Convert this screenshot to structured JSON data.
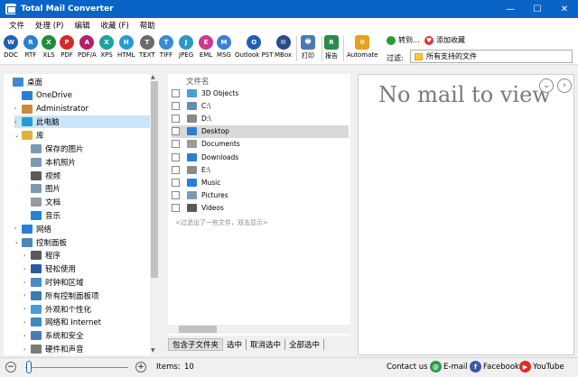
{
  "window": {
    "title": "Total Mail Converter",
    "minimize": "—",
    "maximize": "☐",
    "close": "✕"
  },
  "menu": [
    "文件",
    "处理 (P)",
    "编辑",
    "收藏 (F)",
    "帮助"
  ],
  "toolbar": {
    "formats": [
      {
        "label": "DOC",
        "icon": "W",
        "color": "#1f5fb4"
      },
      {
        "label": "RTF",
        "icon": "R",
        "color": "#2a7fd4"
      },
      {
        "label": "XLS",
        "icon": "X",
        "color": "#1f8c3c"
      },
      {
        "label": "PDF",
        "icon": "P",
        "color": "#d42a2a"
      },
      {
        "label": "PDF/A",
        "icon": "A",
        "color": "#b51f6a"
      },
      {
        "label": "XPS",
        "icon": "X",
        "color": "#1aa3a3"
      },
      {
        "label": "HTML",
        "icon": "H",
        "color": "#2a9ad4"
      },
      {
        "label": "TEXT",
        "icon": "T",
        "color": "#6a6a6a"
      },
      {
        "label": "TIFF",
        "icon": "T",
        "color": "#3a8ad4"
      },
      {
        "label": "JPEG",
        "icon": "J",
        "color": "#2a9ac0"
      },
      {
        "label": "EML",
        "icon": "E",
        "color": "#c93a8a"
      },
      {
        "label": "MSG",
        "icon": "M",
        "color": "#3a7fd4"
      },
      {
        "label": "Outlook PST",
        "icon": "O",
        "color": "#1f5fb4"
      },
      {
        "label": "MBox",
        "icon": "✉",
        "color": "#2a4a8a"
      }
    ],
    "print": {
      "label": "打印",
      "icon": "🖶",
      "color": "#4a7ab4"
    },
    "report": {
      "label": "报告",
      "icon": "R",
      "color": "#2a8a4a"
    },
    "automate": {
      "label": "Automate",
      "icon": "⚙",
      "color": "#e8a020"
    },
    "goto": "转到...",
    "add_favorite": "添加收藏",
    "filter_label": "过滤:",
    "filter_value": "所有支持的文件"
  },
  "tree": [
    {
      "label": "桌面",
      "indent": 0,
      "arrow": "",
      "icon": "#3a8ad4"
    },
    {
      "label": "OneDrive",
      "indent": 1,
      "arrow": "",
      "icon": "#2a7fd4"
    },
    {
      "label": "Administrator",
      "indent": 1,
      "arrow": "›",
      "icon": "#c88a40"
    },
    {
      "label": "此电脑",
      "indent": 1,
      "arrow": "›",
      "icon": "#2a9ad4",
      "selected": true
    },
    {
      "label": "库",
      "indent": 1,
      "arrow": "⌄",
      "icon": "#e0b040"
    },
    {
      "label": "保存的图片",
      "indent": 2,
      "arrow": "",
      "icon": "#7a9ab4"
    },
    {
      "label": "本机照片",
      "indent": 2,
      "arrow": "",
      "icon": "#7a9ab4"
    },
    {
      "label": "视频",
      "indent": 2,
      "arrow": "",
      "icon": "#5a5a5a"
    },
    {
      "label": "图片",
      "indent": 2,
      "arrow": "",
      "icon": "#7a9ab4"
    },
    {
      "label": "文档",
      "indent": 2,
      "arrow": "",
      "icon": "#9a9a9a"
    },
    {
      "label": "音乐",
      "indent": 2,
      "arrow": "",
      "icon": "#2a7fd4"
    },
    {
      "label": "网络",
      "indent": 1,
      "arrow": "›",
      "icon": "#2a7fd4"
    },
    {
      "label": "控制面板",
      "indent": 1,
      "arrow": "⌄",
      "icon": "#4a8ab4"
    },
    {
      "label": "程序",
      "indent": 2,
      "arrow": "›",
      "icon": "#5a5a5a"
    },
    {
      "label": "轻松使用",
      "indent": 2,
      "arrow": "›",
      "icon": "#2a5aa4"
    },
    {
      "label": "时钟和区域",
      "indent": 2,
      "arrow": "›",
      "icon": "#4a8ac4"
    },
    {
      "label": "所有控制面板项",
      "indent": 2,
      "arrow": "›",
      "icon": "#3a7ab4"
    },
    {
      "label": "外观和个性化",
      "indent": 2,
      "arrow": "›",
      "icon": "#4a9ad4"
    },
    {
      "label": "网络和 Internet",
      "indent": 2,
      "arrow": "›",
      "icon": "#3a8ac4"
    },
    {
      "label": "系统和安全",
      "indent": 2,
      "arrow": "›",
      "icon": "#4a7ab4"
    },
    {
      "label": "硬件和声音",
      "indent": 2,
      "arrow": "›",
      "icon": "#7a7a7a"
    }
  ],
  "files": {
    "header": "文件名",
    "rows": [
      {
        "name": "3D Objects",
        "icon": "#4aa0d4"
      },
      {
        "name": "C:\\",
        "icon": "#6a8ab4"
      },
      {
        "name": "D:\\",
        "icon": "#8a8a8a"
      },
      {
        "name": "Desktop",
        "icon": "#2a7fd4",
        "selected": true
      },
      {
        "name": "Documents",
        "icon": "#9a9a9a"
      },
      {
        "name": "Downloads",
        "icon": "#2a7fd4"
      },
      {
        "name": "E:\\",
        "icon": "#8a8a8a"
      },
      {
        "name": "Music",
        "icon": "#2a7fd4"
      },
      {
        "name": "Pictures",
        "icon": "#7a9ab4"
      },
      {
        "name": "Videos",
        "icon": "#5a5a5a"
      }
    ],
    "hint": "<过滤出了一些文件，双击显示>"
  },
  "bottom_buttons": [
    "包含子文件夹",
    "选中",
    "取消选中",
    "全部选中"
  ],
  "preview": {
    "message": "No mail to view",
    "prev": "⌄",
    "next": "›"
  },
  "status": {
    "zoom_minus": "−",
    "zoom_plus": "+",
    "items_label": "Items:",
    "items_value": "10",
    "contact": "Contact us",
    "email": "E-mail",
    "facebook": "Facebook",
    "youtube": "YouTube"
  }
}
